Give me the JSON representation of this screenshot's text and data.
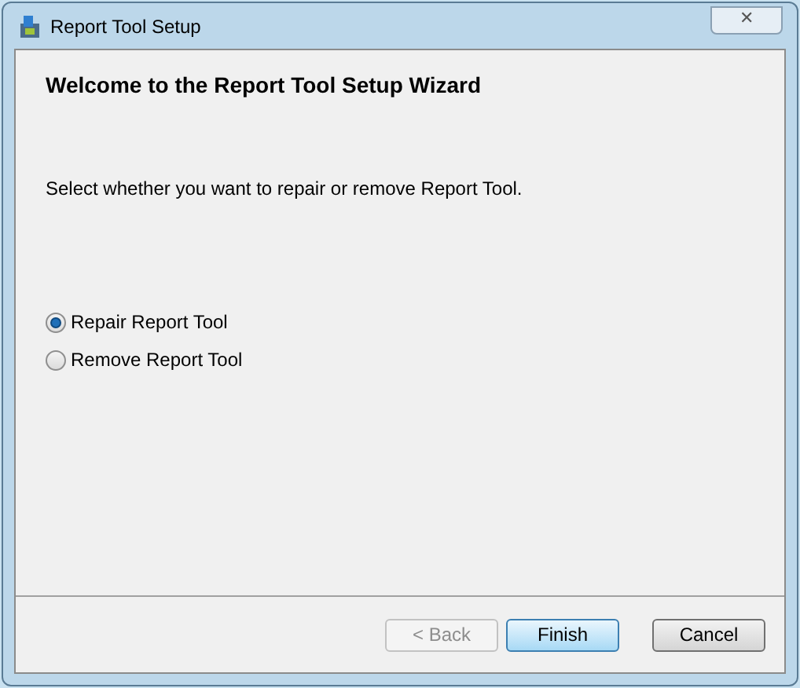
{
  "window": {
    "title": "Report Tool Setup",
    "close_symbol": "✕"
  },
  "heading": "Welcome to the Report Tool Setup Wizard",
  "instruction": "Select whether you want to repair or remove Report Tool.",
  "options": [
    {
      "label": "Repair Report Tool",
      "selected": true
    },
    {
      "label": "Remove Report Tool",
      "selected": false
    }
  ],
  "buttons": [
    {
      "label": "< Back",
      "disabled": true,
      "default": false
    },
    {
      "label": "Finish",
      "disabled": false,
      "default": true
    },
    {
      "label": "Cancel",
      "disabled": false,
      "default": false
    }
  ]
}
